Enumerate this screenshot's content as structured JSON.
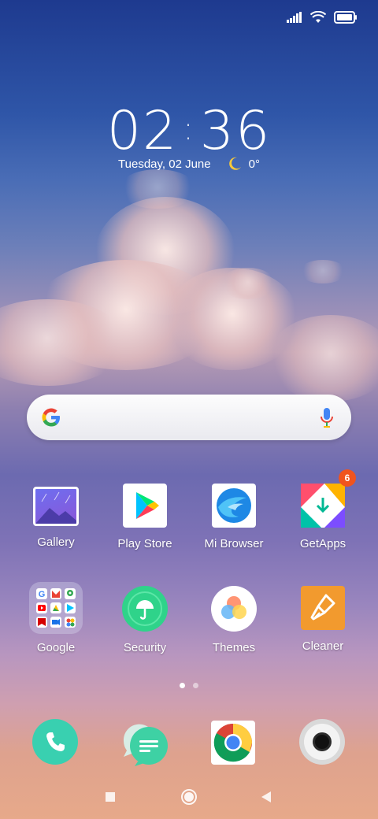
{
  "status_bar": {
    "icons": [
      "signal-icon",
      "wifi-icon",
      "battery-icon"
    ]
  },
  "clock": {
    "hours": "02",
    "minutes": "36",
    "date": "Tuesday, 02 June",
    "temperature": "0°",
    "weather_icon": "moon-icon"
  },
  "search": {
    "logo": "google-g-icon",
    "mic": "mic-icon"
  },
  "apps_row1": [
    {
      "label": "Gallery"
    },
    {
      "label": "Play Store"
    },
    {
      "label": "Mi Browser"
    },
    {
      "label": "GetApps",
      "badge": "6"
    }
  ],
  "apps_row2": [
    {
      "label": "Google"
    },
    {
      "label": "Security"
    },
    {
      "label": "Themes"
    },
    {
      "label": "Cleaner"
    }
  ],
  "pager": {
    "pages": 2,
    "current": 1
  },
  "dock": [
    "phone-icon",
    "messages-icon",
    "chrome-icon",
    "camera-icon"
  ],
  "nav": [
    "recents-icon",
    "home-icon",
    "back-icon"
  ],
  "colors": {
    "badge": "#f0541e",
    "security": "#2fd38a",
    "phone": "#39d0b0",
    "cleaner": "#f29a2e"
  }
}
